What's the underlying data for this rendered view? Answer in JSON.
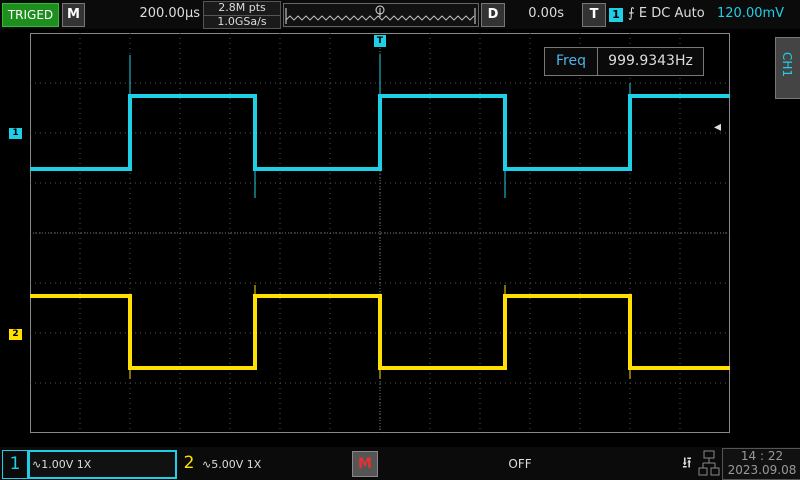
{
  "top": {
    "status": "TRIGED",
    "mode_key": "M",
    "timebase": "200.00µs",
    "mem_depth": "2.8M pts",
    "sample_rate": "1.0GSa/s",
    "delay_key": "D",
    "delay_value": "0.00s",
    "trigger_key": "T",
    "trigger_source": "1",
    "trigger_info": "⨍ E DC Auto",
    "trigger_level": "120.00mV"
  },
  "measure": {
    "label": "Freq",
    "value": "999.9343Hz"
  },
  "side_tab": "CH1",
  "markers": {
    "ch1": "1",
    "ch2": "2",
    "trigger_pos": "T",
    "level_arrow": "◂"
  },
  "bottom": {
    "ch1_number": "1",
    "ch1_settings": "∿1.00V 1X",
    "ch2_number": "2",
    "ch2_settings": "∿5.00V 1X",
    "math_key": "M",
    "math_state": "OFF",
    "usb_icon": "⭿",
    "time": "14 : 22",
    "date": "2023.09.08"
  },
  "colors": {
    "ch1": "#1fcfe6",
    "ch2": "#ffe000",
    "trig": "#1e8e1e",
    "math": "#e83030"
  }
}
